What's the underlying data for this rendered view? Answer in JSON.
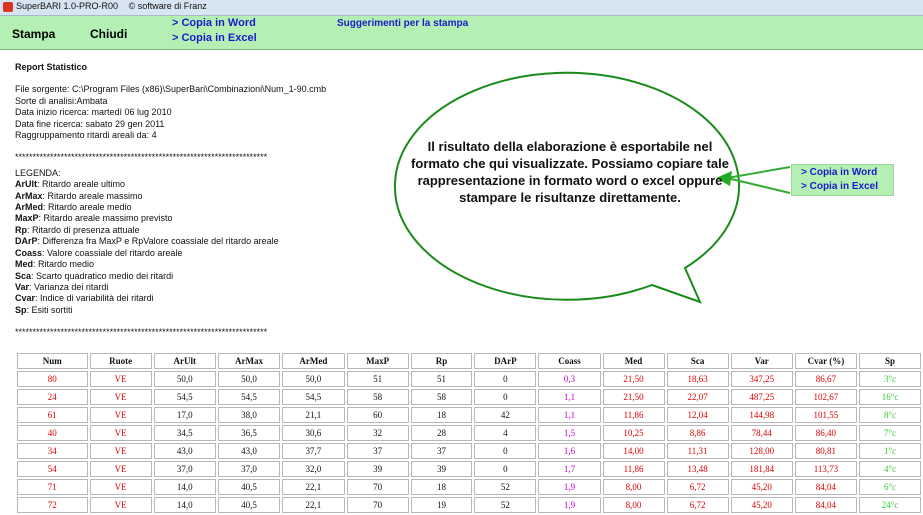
{
  "titlebar": {
    "app": "SuperBARI 1.0-PRO-R00",
    "copyright": "© software di Franz"
  },
  "toolbar": {
    "stampa": "Stampa",
    "chiudi": "Chiudi",
    "copia_word": "> Copia in Word",
    "copia_excel": "> Copia in Excel",
    "suggerimenti": "Suggerimenti per la stampa"
  },
  "report": {
    "title": "Report Statistico",
    "lines": [
      "File sorgente: C:\\Program Files (x86)\\SuperBari\\Combinazioni\\Num_1-90.cmb",
      "Sorte di analisi:Ambata",
      "Data inizio ricerca: martedì 06 lug 2010",
      "Data fine ricerca: sabato 29 gen 2011",
      "Raggruppamento ritardi areali da: 4"
    ],
    "separator": "************************************************************************",
    "legenda_title": "LEGENDA:",
    "legend": [
      {
        "k": "ArUlt",
        "v": ": Ritardo areale ultimo"
      },
      {
        "k": "ArMax",
        "v": ": Ritardo areale massimo"
      },
      {
        "k": "ArMed",
        "v": ": Ritardo areale medio"
      },
      {
        "k": "MaxP",
        "v": ": Ritardo areale massimo previsto"
      },
      {
        "k": "Rp",
        "v": ": Ritardo di presenza attuale"
      },
      {
        "k": "DArP",
        "v": ": Differenza fra MaxP e RpValore coassiale del ritardo areale"
      },
      {
        "k": "Coass",
        "v": ": Valore coassiale del ritardo areale"
      },
      {
        "k": "Med",
        "v": ": Ritardo medio"
      },
      {
        "k": "Sca",
        "v": ": Scarto quadratico medio dei ritardi"
      },
      {
        "k": "Var",
        "v": ": Varianza dei ritardi"
      },
      {
        "k": "Cvar",
        "v": ": Indice di variabilità dei ritardi"
      },
      {
        "k": "Sp",
        "v": ": Esiti sortiti"
      }
    ]
  },
  "callout": {
    "text": "Il risultato della elaborazione è esportabile nel formato che qui visualizzate. Possiamo copiare tale rappresentazione in formato word o excel oppure stampare le risultanze direttamente.",
    "copia_word": "> Copia in Word",
    "copia_excel": "> Copia in Excel"
  },
  "table": {
    "headers": [
      "Num",
      "Ruote",
      "ArUlt",
      "ArMax",
      "ArMed",
      "MaxP",
      "Rp",
      "DArP",
      "Coass",
      "Med",
      "Sca",
      "Var",
      "Cvar (%)",
      "Sp"
    ],
    "rows": [
      [
        "80",
        "VE",
        "50,0",
        "50,0",
        "50,0",
        "51",
        "51",
        "0",
        "0,3",
        "21,50",
        "18,63",
        "347,25",
        "86,67",
        "3°c"
      ],
      [
        "24",
        "VE",
        "54,5",
        "54,5",
        "54,5",
        "58",
        "58",
        "0",
        "1,1",
        "21,50",
        "22,07",
        "487,25",
        "102,67",
        "16°c"
      ],
      [
        "61",
        "VE",
        "17,0",
        "38,0",
        "21,1",
        "60",
        "18",
        "42",
        "1,1",
        "11,86",
        "12,04",
        "144,98",
        "101,55",
        "8°c"
      ],
      [
        "40",
        "VE",
        "34,5",
        "36,5",
        "30,6",
        "32",
        "28",
        "4",
        "1,5",
        "10,25",
        "8,86",
        "78,44",
        "86,40",
        "7°c"
      ],
      [
        "34",
        "VE",
        "43,0",
        "43,0",
        "37,7",
        "37",
        "37",
        "0",
        "1,6",
        "14,00",
        "11,31",
        "128,00",
        "80,81",
        "1°c"
      ],
      [
        "54",
        "VE",
        "37,0",
        "37,0",
        "32,0",
        "39",
        "39",
        "0",
        "1,7",
        "11,86",
        "13,48",
        "181,84",
        "113,73",
        "4°c"
      ],
      [
        "71",
        "VE",
        "14,0",
        "40,5",
        "22,1",
        "70",
        "18",
        "52",
        "1,9",
        "8,00",
        "6,72",
        "45,20",
        "84,04",
        "6°c"
      ],
      [
        "72",
        "VE",
        "14,0",
        "40,5",
        "22,1",
        "70",
        "19",
        "52",
        "1,9",
        "8,00",
        "6,72",
        "45,20",
        "84,04",
        "24°c"
      ]
    ]
  },
  "colors": {
    "toolbar_bg": "#b4f0b4",
    "link": "#1a1acc",
    "red": "#e00000",
    "magenta": "#d000d0",
    "green": "#33cc33",
    "bubble_stroke": "#1a8a1a"
  }
}
